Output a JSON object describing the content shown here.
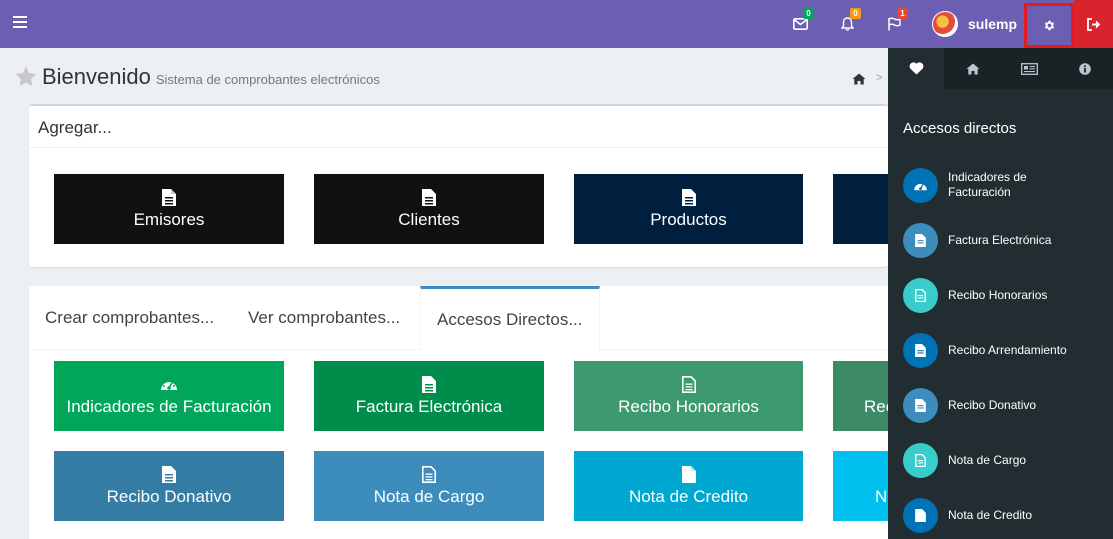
{
  "header": {
    "messages_badge": "0",
    "notifications_badge": "0",
    "flags_badge": "1",
    "username": "sulemp"
  },
  "page": {
    "title": "Bienvenido",
    "subtitle": "Sistema de comprobantes electrónicos"
  },
  "add_box": {
    "title": "Agregar...",
    "tiles": [
      {
        "label": "Emisores",
        "color": "#111111"
      },
      {
        "label": "Clientes",
        "color": "#111111"
      },
      {
        "label": "Productos",
        "color": "#001f3f"
      },
      {
        "label": "",
        "color": "#001f3f"
      }
    ]
  },
  "tabs": [
    {
      "label": "Crear comprobantes..."
    },
    {
      "label": "Ver comprobantes..."
    },
    {
      "label": "Accesos Directos..."
    }
  ],
  "direct_access_tiles": [
    {
      "label": "Indicadores de Facturación",
      "color": "#00a65a",
      "icon": "dashboard-icon"
    },
    {
      "label": "Factura Electrónica",
      "color": "#008d4c",
      "icon": "file-icon"
    },
    {
      "label": "Recibo Honorarios",
      "color": "#3d9970",
      "icon": "file-text-icon"
    },
    {
      "label": "Rec",
      "color": "#3d8b66",
      "icon": ""
    },
    {
      "label": "Recibo Donativo",
      "color": "#357ca5",
      "icon": "file-text-icon"
    },
    {
      "label": "Nota de Cargo",
      "color": "#3c8dbc",
      "icon": "file-text-icon"
    },
    {
      "label": "Nota de Credito",
      "color": "#00a7d0",
      "icon": "file-icon"
    },
    {
      "label": "N",
      "color": "#00c0ef",
      "icon": ""
    }
  ],
  "control_sidebar": {
    "heading": "Accesos directos",
    "items": [
      {
        "label": "Indicadores de Facturación",
        "color": "#0073b7",
        "icon": "dashboard-icon"
      },
      {
        "label": "Factura Electrónica",
        "color": "#3c8dbc",
        "icon": "file-icon"
      },
      {
        "label": "Recibo Honorarios",
        "color": "#39cccc",
        "icon": "file-text-icon"
      },
      {
        "label": "Recibo Arrendamiento",
        "color": "#0073b7",
        "icon": "file-text-icon"
      },
      {
        "label": "Recibo Donativo",
        "color": "#3c8dbc",
        "icon": "file-text-icon"
      },
      {
        "label": "Nota de Cargo",
        "color": "#39cccc",
        "icon": "file-text-icon"
      },
      {
        "label": "Nota de Credito",
        "color": "#0073b7",
        "icon": "file-icon"
      }
    ]
  }
}
